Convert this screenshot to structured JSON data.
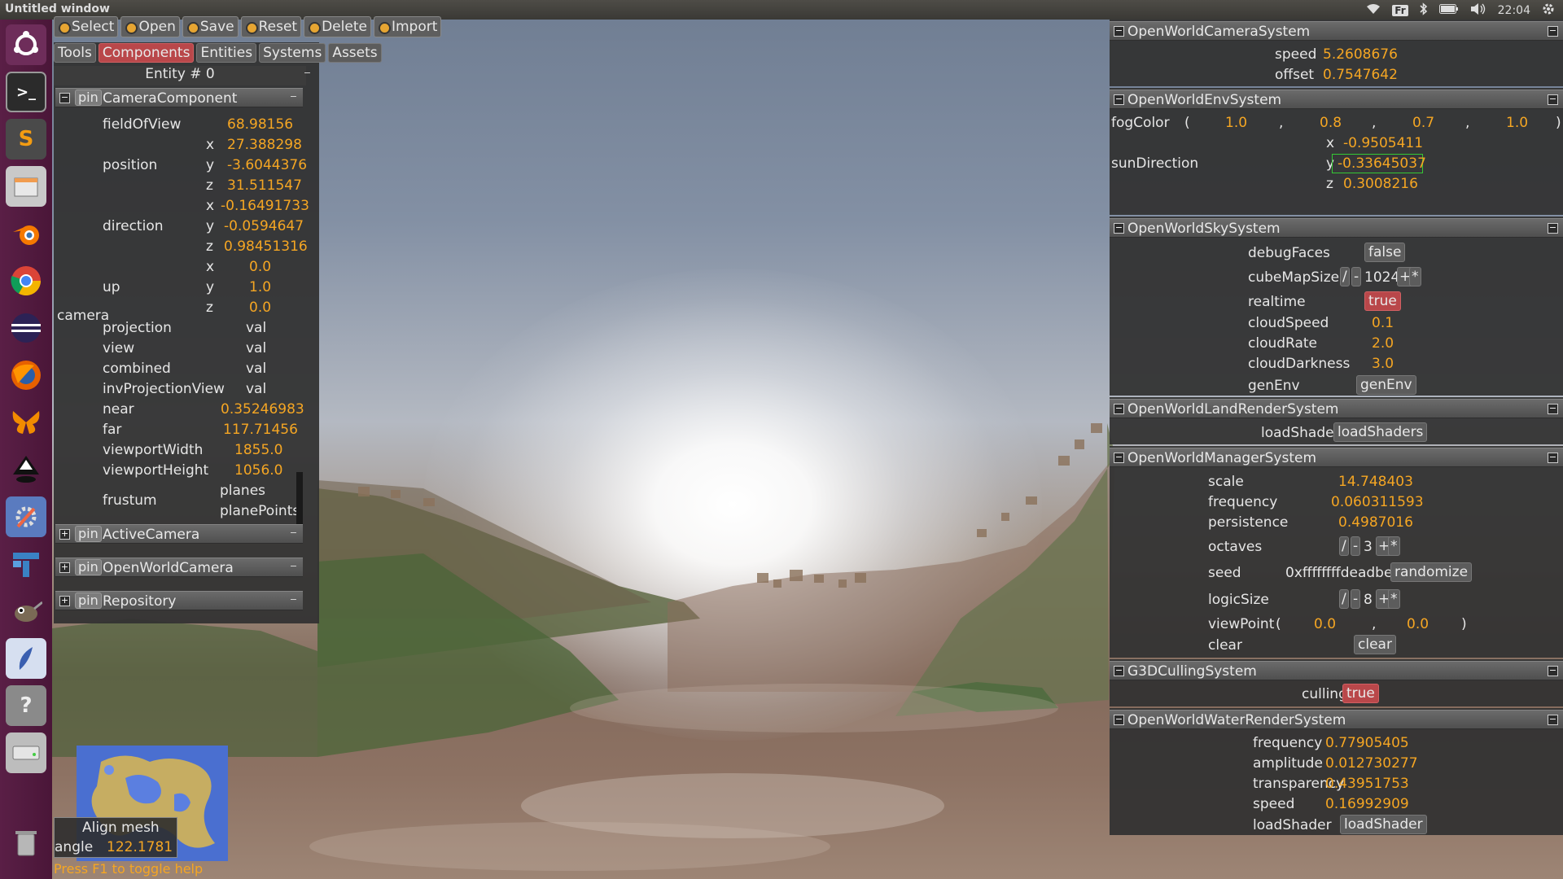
{
  "window_title": "Untitled window",
  "tray": {
    "keyboard": "Fr",
    "clock": "22:04"
  },
  "toolbar": [
    "Select",
    "Open",
    "Save",
    "Reset",
    "Delete",
    "Import"
  ],
  "tabs": [
    "Tools",
    "Components",
    "Entities",
    "Systems",
    "Assets"
  ],
  "active_tab": "Components",
  "entity_title": "Entity # 0",
  "camera_component": {
    "title": "CameraComponent",
    "pin": "pin",
    "group_label": "camera",
    "fieldOfView": {
      "label": "fieldOfView",
      "value": "68.98156"
    },
    "position": {
      "label": "position",
      "x": "27.388298",
      "y": "-3.6044376",
      "z": "31.511547"
    },
    "direction": {
      "label": "direction",
      "x": "-0.16491733",
      "y": "-0.0594647",
      "z": "0.98451316"
    },
    "up": {
      "label": "up",
      "x": "0.0",
      "y": "1.0",
      "z": "0.0"
    },
    "projection": {
      "label": "projection",
      "value": "val"
    },
    "view": {
      "label": "view",
      "value": "val"
    },
    "combined": {
      "label": "combined",
      "value": "val"
    },
    "invProjectionView": {
      "label": "invProjectionView",
      "value": "val"
    },
    "near": {
      "label": "near",
      "value": "0.35246983"
    },
    "far": {
      "label": "far",
      "value": "117.71456"
    },
    "viewportWidth": {
      "label": "viewportWidth",
      "value": "1855.0"
    },
    "viewportHeight": {
      "label": "viewportHeight",
      "value": "1056.0"
    },
    "frustum": {
      "label": "frustum",
      "planes": "planes",
      "planePoints": "planePoints"
    }
  },
  "other_components": [
    {
      "pin": "pin",
      "title": "ActiveCamera"
    },
    {
      "pin": "pin",
      "title": "OpenWorldCamera"
    },
    {
      "pin": "pin",
      "title": "Repository"
    }
  ],
  "systems": {
    "camera": {
      "title": "OpenWorldCameraSystem",
      "speed_label": "speed",
      "speed": "5.2608676",
      "offset_label": "offset",
      "offset": "0.7547642"
    },
    "env": {
      "title": "OpenWorldEnvSystem",
      "fog_label": "fogColor",
      "fog": [
        "1.0",
        "0.8",
        "0.7",
        "1.0"
      ],
      "sun_label": "sunDirection",
      "sun_x": "-0.9505411",
      "sun_y": "-0.33645037",
      "sun_z": "0.3008216"
    },
    "sky": {
      "title": "OpenWorldSkySystem",
      "debugFaces_label": "debugFaces",
      "debugFaces": "false",
      "cubeMapSize_label": "cubeMapSize",
      "cubeMapSize": "1024",
      "realtime_label": "realtime",
      "realtime": "true",
      "cloudSpeed_label": "cloudSpeed",
      "cloudSpeed": "0.1",
      "cloudRate_label": "cloudRate",
      "cloudRate": "2.0",
      "cloudDarkness_label": "cloudDarkness",
      "cloudDarkness": "3.0",
      "genEnv_label": "genEnv",
      "genEnv": "genEnv"
    },
    "land": {
      "title": "OpenWorldLandRenderSystem",
      "loadShaders_label": "loadShaders",
      "loadShaders": "loadShaders"
    },
    "manager": {
      "title": "OpenWorldManagerSystem",
      "scale_label": "scale",
      "scale": "14.748403",
      "frequency_label": "frequency",
      "frequency": "0.060311593",
      "persistence_label": "persistence",
      "persistence": "0.4987016",
      "octaves_label": "octaves",
      "octaves": "3",
      "seed_label": "seed",
      "seed": "0xffffffffdeadbeef",
      "randomize": "randomize",
      "logicSize_label": "logicSize",
      "logicSize": "8",
      "viewPoint_label": "viewPoint",
      "viewPoint_x": "0.0",
      "viewPoint_y": "0.0",
      "clear_label": "clear",
      "clear": "clear"
    },
    "culling": {
      "title": "G3DCullingSystem",
      "culling_label": "culling",
      "culling": "true"
    },
    "water": {
      "title": "OpenWorldWaterRenderSystem",
      "frequency_label": "frequency",
      "frequency": "0.77905405",
      "amplitude_label": "amplitude",
      "amplitude": "0.012730277",
      "transparency_label": "transparency",
      "transparency": "0.43951753",
      "speed_label": "speed",
      "speed": "0.16992909",
      "loadShader_label": "loadShader",
      "loadShader": "loadShader"
    }
  },
  "hud": {
    "align": "Align mesh",
    "angle_label": "angle",
    "angle": "122.1781",
    "help": "Press F1 to toggle help"
  }
}
